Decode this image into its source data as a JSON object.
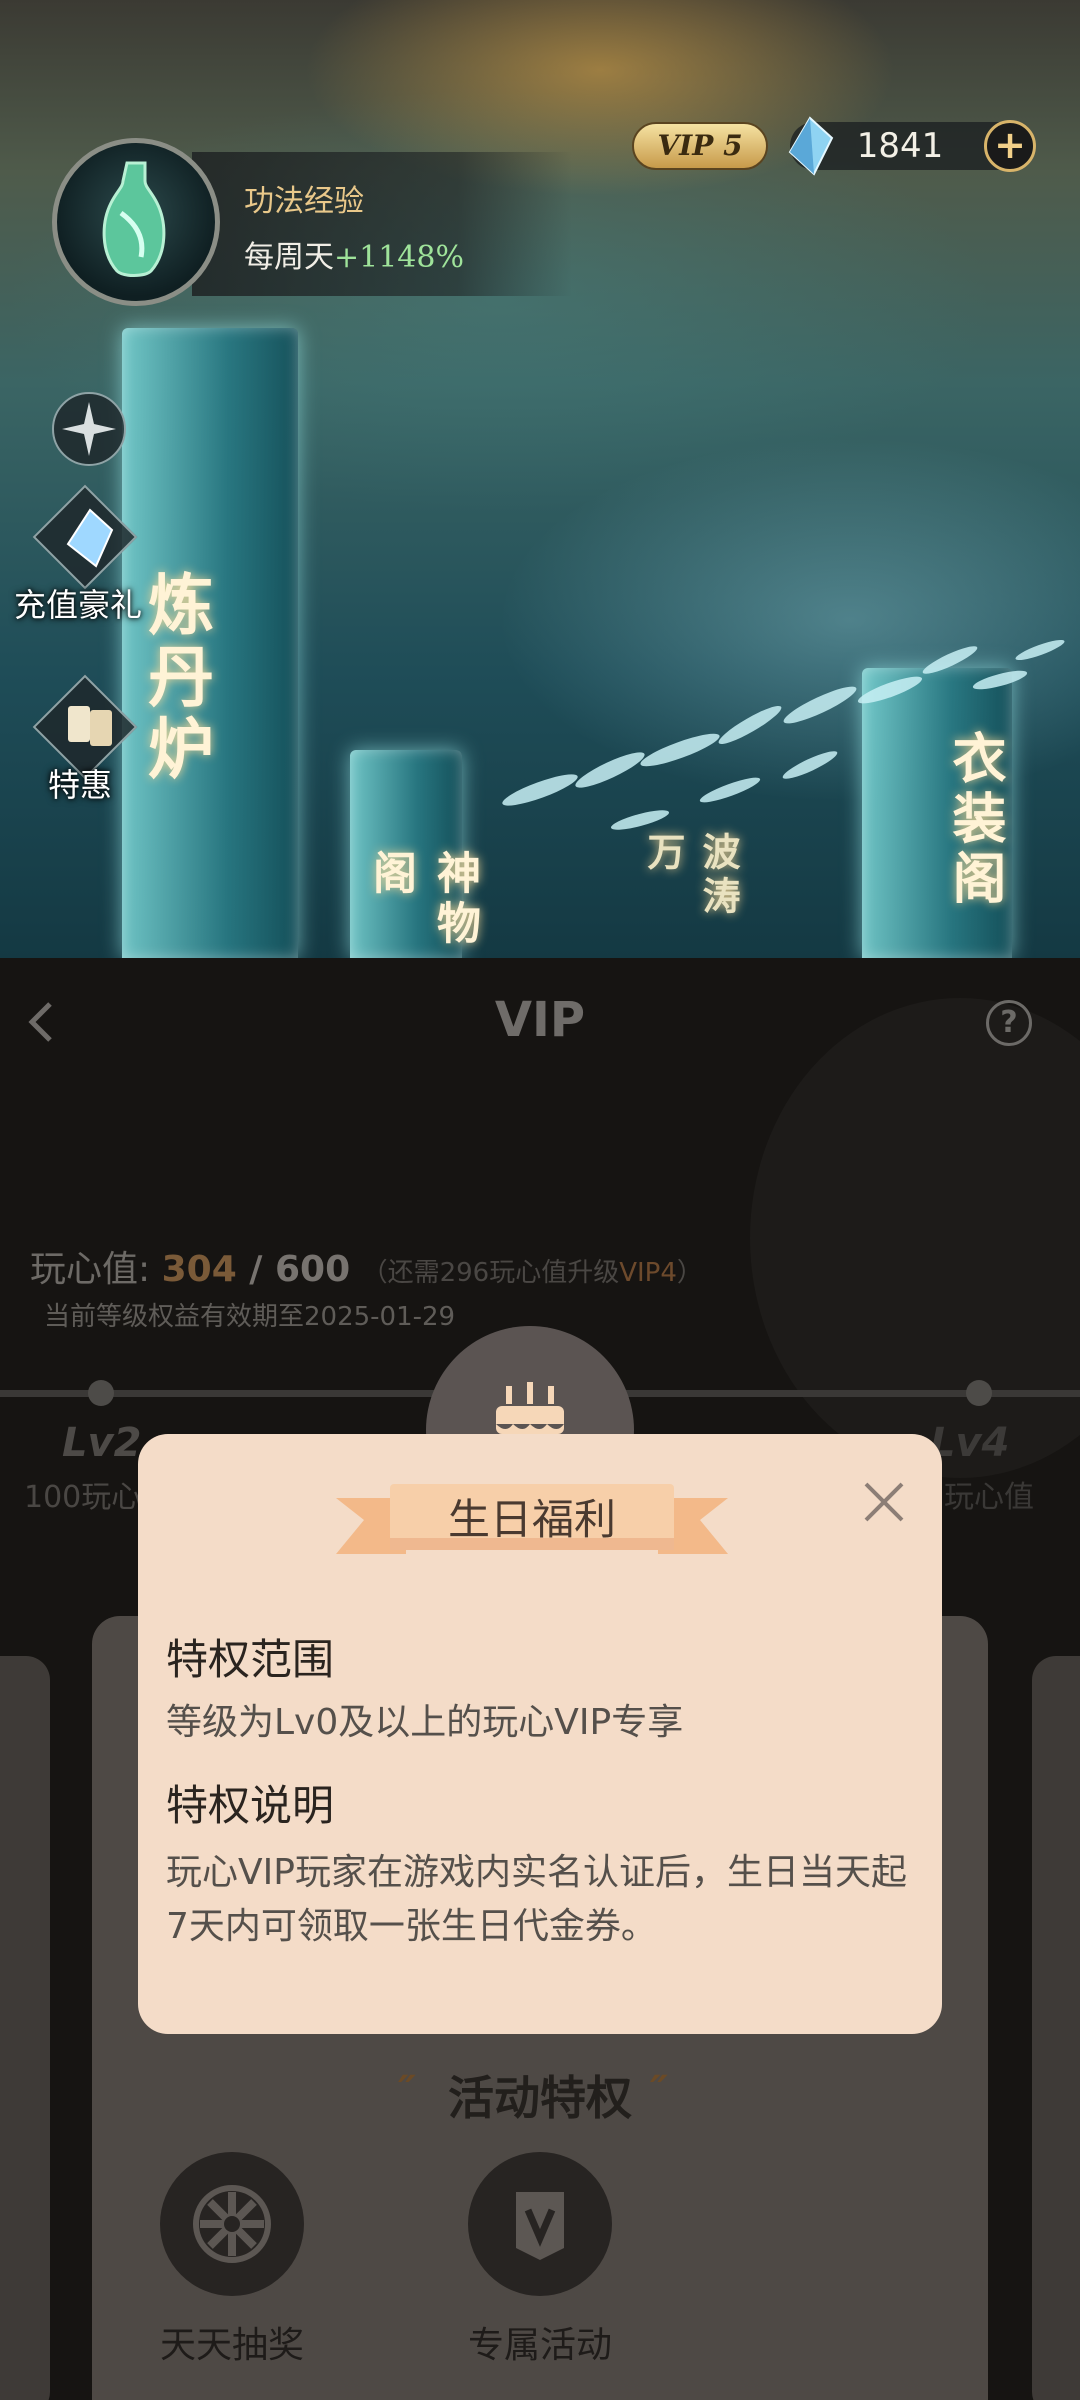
{
  "game": {
    "exp_title": "功法经验",
    "exp_prefix": "每周天",
    "exp_bonus": "+1148%",
    "vip_level": "VIP 5",
    "gem_count": "1841",
    "plus_label": "+",
    "side_buttons": [
      "充值豪礼",
      "特惠"
    ],
    "building_labels": [
      "炼丹炉",
      "神物阁",
      "波涛万",
      "衣装阁"
    ]
  },
  "vip_page": {
    "back_label": "‹",
    "title": "VIP",
    "help_label": "?",
    "score_label": "玩心值:",
    "score_current": "304",
    "score_sep": " / ",
    "score_max": "600",
    "score_hint_prefix": "（还需296玩心值升级",
    "score_hint_level": "VIP4",
    "score_hint_suffix": "）",
    "validity": "当前等级权益有效期至2025-01-29",
    "progress_left_level": "Lv2",
    "progress_left_sub": "100玩心",
    "progress_right_level": "Lv4",
    "progress_right_sub": "玩心值",
    "activity_title": "活动特权",
    "activities": [
      {
        "label": "天天抽奖",
        "icon": "wheel-icon"
      },
      {
        "label": "专属活动",
        "icon": "v-badge-icon"
      }
    ]
  },
  "modal": {
    "title": "生日福利",
    "section1_title": "特权范围",
    "section1_body": "等级为Lv0及以上的玩心VIP专享",
    "section2_title": "特权说明",
    "section2_body": "玩心VIP玩家在游戏内实名认证后，生日当天起7天内可领取一张生日代金券。"
  },
  "colors": {
    "modal_bg": "#f4dcc8",
    "ribbon": "#f6c9a2",
    "accent_gold": "#d8b46a",
    "bonus_green": "#9fe39a"
  }
}
